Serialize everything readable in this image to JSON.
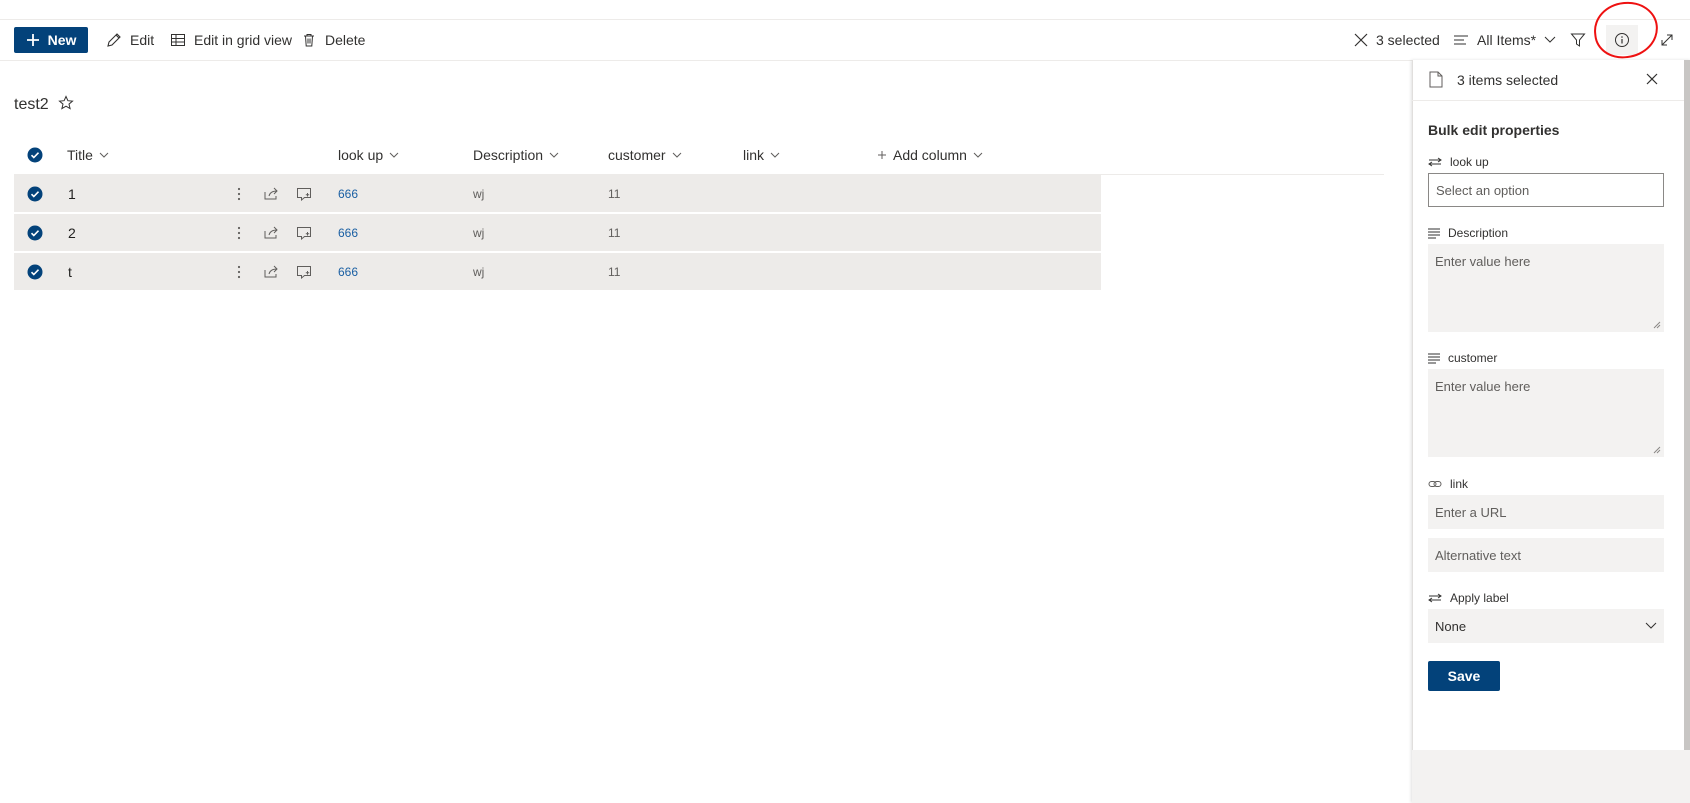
{
  "toolbar": {
    "new_label": "New",
    "edit_label": "Edit",
    "edit_grid_label": "Edit in grid view",
    "delete_label": "Delete",
    "selected_label": "3 selected",
    "view_label": "All Items*"
  },
  "list": {
    "title": "test2",
    "columns": {
      "title": "Title",
      "lookup": "look up",
      "description": "Description",
      "customer": "customer",
      "link": "link",
      "add": "Add column"
    },
    "rows": [
      {
        "title": "1",
        "lookup": "666",
        "description": "wj",
        "customer": "11"
      },
      {
        "title": "2",
        "lookup": "666",
        "description": "wj",
        "customer": "11"
      },
      {
        "title": "t",
        "lookup": "666",
        "description": "wj",
        "customer": "11"
      }
    ]
  },
  "pane": {
    "header": "3 items selected",
    "section_title": "Bulk edit properties",
    "lookup_label": "look up",
    "lookup_placeholder": "Select an option",
    "description_label": "Description",
    "description_placeholder": "Enter value here",
    "customer_label": "customer",
    "customer_placeholder": "Enter value here",
    "link_label": "link",
    "link_url_placeholder": "Enter a URL",
    "link_alt_placeholder": "Alternative text",
    "apply_label_label": "Apply label",
    "apply_label_value": "None",
    "save_label": "Save"
  },
  "colors": {
    "brand": "#03427a",
    "annotation": "#ee1111",
    "selected_row": "#edebe9"
  }
}
